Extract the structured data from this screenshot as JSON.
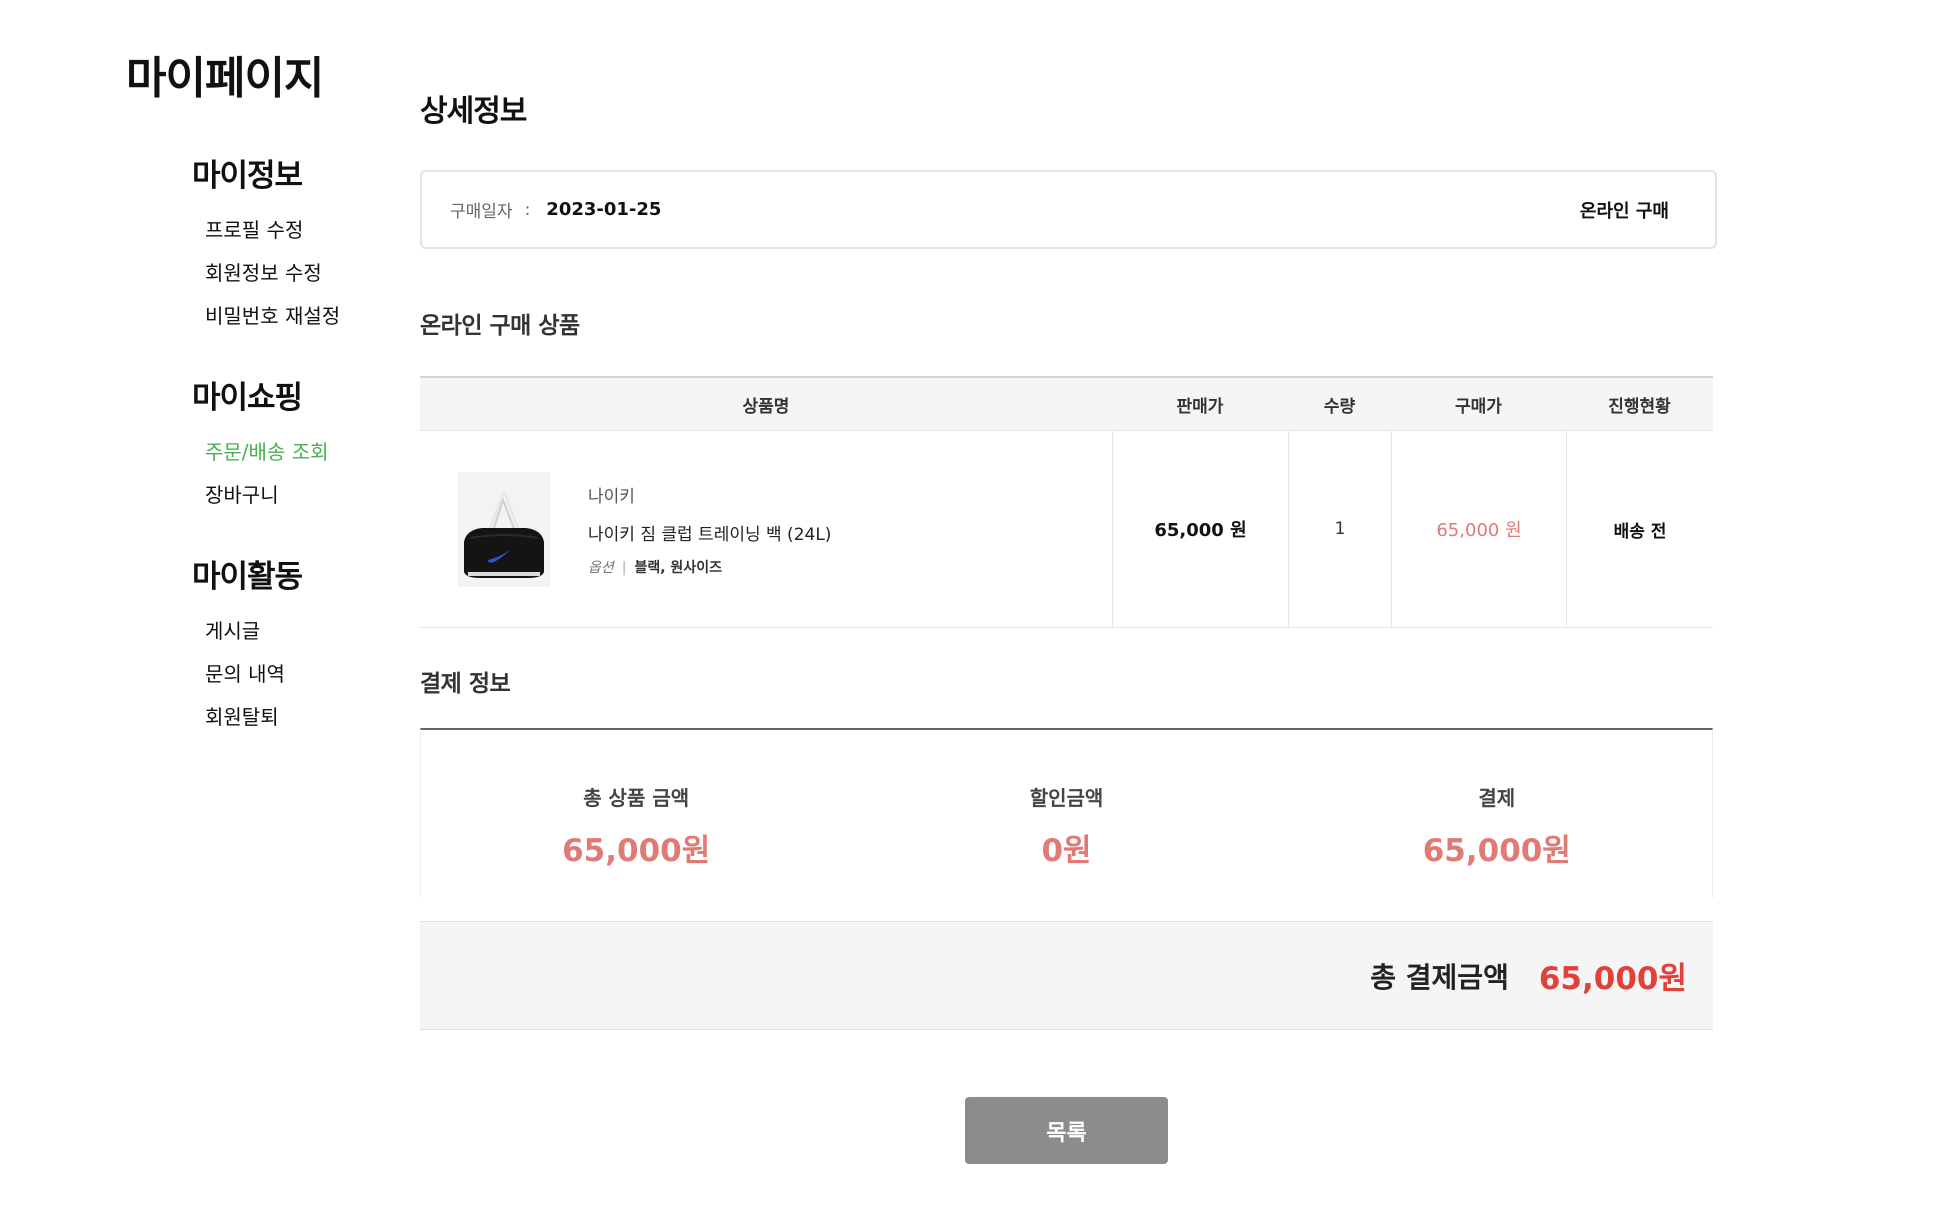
{
  "sidebar": {
    "title": "마이페이지",
    "groups": [
      {
        "title": "마이정보",
        "items": [
          {
            "label": "프로필 수정"
          },
          {
            "label": "회원정보 수정"
          },
          {
            "label": "비밀번호 재설정"
          }
        ]
      },
      {
        "title": "마이쇼핑",
        "items": [
          {
            "label": "주문/배송 조회"
          },
          {
            "label": "장바구니"
          }
        ]
      },
      {
        "title": "마이활동",
        "items": [
          {
            "label": "게시글"
          },
          {
            "label": "문의 내역"
          },
          {
            "label": "회원탈퇴"
          }
        ]
      }
    ],
    "active_item": "주문/배송 조회"
  },
  "main": {
    "title": "상세정보",
    "purchase": {
      "date_label": "구매일자",
      "colon": ":",
      "date": "2023-01-25",
      "type": "온라인 구매"
    },
    "products_title": "온라인 구매 상품",
    "table": {
      "headers": [
        "상품명",
        "판매가",
        "수량",
        "구매가",
        "진행현황"
      ],
      "rows": [
        {
          "brand": "나이키",
          "name": "나이키 짐 클럽 트레이닝 백 (24L)",
          "option_label": "옵션",
          "option_sep": "|",
          "option_value": "블랙, 원사이즈",
          "sale_price": "65,000 원",
          "quantity": "1",
          "purchase_price": "65,000 원",
          "status": "배송 전"
        }
      ]
    },
    "payment_title": "결제 정보",
    "payment": [
      {
        "label": "총 상품 금액",
        "value": "65,000원"
      },
      {
        "label": "할인금액",
        "value": "0원"
      },
      {
        "label": "결제",
        "value": "65,000원"
      }
    ],
    "total": {
      "label": "총 결제금액",
      "value": "65,000원"
    },
    "list_button": "목록"
  },
  "colors": {
    "active_menu": "#4caf50",
    "price_red": "#e07a75",
    "total_red": "#e0413a",
    "button_gray": "#8c8c8c"
  }
}
